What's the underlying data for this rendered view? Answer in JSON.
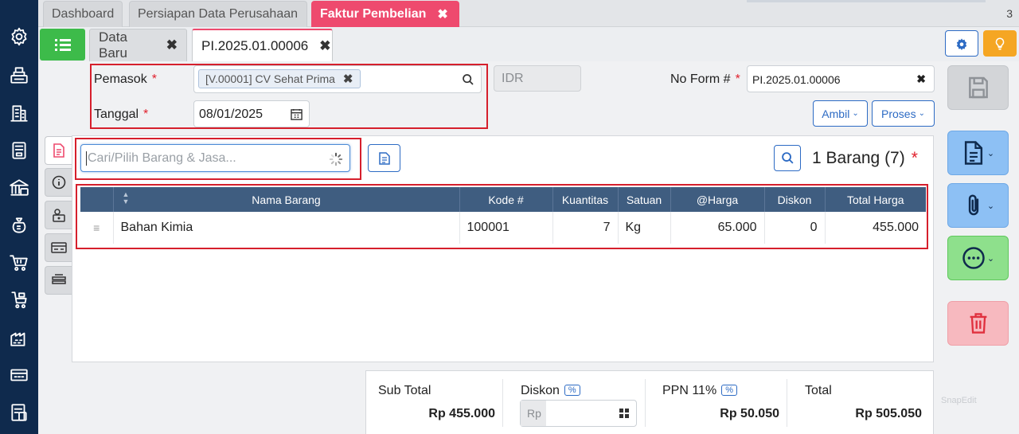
{
  "top_tabs": [
    {
      "label": "Dashboard"
    },
    {
      "label": "Persiapan Data Perusahaan"
    },
    {
      "label": "Faktur Pembelian"
    }
  ],
  "tab_count": "3",
  "sub_tabs": [
    {
      "label": "Data Baru"
    },
    {
      "label": "PI.2025.01.00006"
    }
  ],
  "form": {
    "supplier_label": "Pemasok",
    "supplier_value": "[V.00001] CV Sehat Prima",
    "currency": "IDR",
    "date_label": "Tanggal",
    "date_value": "08/01/2025",
    "form_no_label": "No Form #",
    "form_no_value": "PI.2025.01.00006",
    "required_mark": "*",
    "ambil_label": "Ambil",
    "proses_label": "Proses"
  },
  "items": {
    "search_placeholder": "Cari/Pilih Barang & Jasa...",
    "count_label": "1 Barang (7)",
    "required_mark": "*",
    "columns": [
      "Nama Barang",
      "Kode #",
      "Kuantitas",
      "Satuan",
      "@Harga",
      "Diskon",
      "Total Harga"
    ],
    "rows": [
      {
        "name": "Bahan Kimia",
        "code": "100001",
        "qty": "7",
        "unit": "Kg",
        "price": "65.000",
        "discount": "0",
        "total": "455.000"
      }
    ]
  },
  "summary": {
    "subtotal_label": "Sub Total",
    "subtotal_value": "Rp 455.000",
    "discount_label": "Diskon",
    "discount_pct": "%",
    "discount_placeholder": "Rp",
    "ppn_label": "PPN 11%",
    "ppn_pct": "%",
    "ppn_value": "Rp 50.050",
    "total_label": "Total",
    "total_value": "Rp 505.050"
  },
  "watermark": "SnapEdit",
  "colors": {
    "nav_bg": "#0f2a4d",
    "accent_pink": "#ee4a6e",
    "accent_blue": "#2d6bc4",
    "header_blue": "#3f5d80",
    "green": "#3dbb4a",
    "orange": "#f5a623",
    "highlight_red": "#d61f2c"
  },
  "icons": {
    "left_nav": [
      "settings-icon",
      "cashier-icon",
      "company-icon",
      "ledger-icon",
      "bank-icon",
      "money-bag-icon",
      "shopping-cart-icon",
      "cart-return-icon",
      "warehouse-icon",
      "factory-icon",
      "tax-report-icon"
    ],
    "right_rail": [
      "save-icon",
      "document-icon",
      "paperclip-icon",
      "more-icon",
      "trash-icon"
    ]
  }
}
